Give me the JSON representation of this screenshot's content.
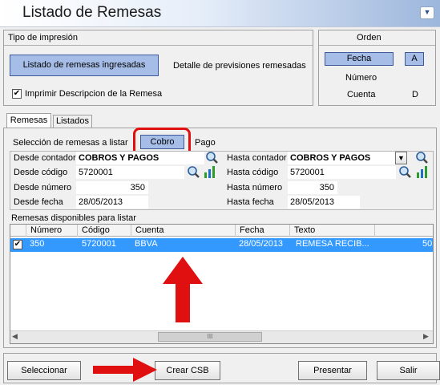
{
  "window": {
    "title": "Listado de Remesas",
    "menu_icon": "chevron-down-icon"
  },
  "tipo_impresion": {
    "title": "Tipo de impresión",
    "btn_ingresadas": "Listado de remesas ingresadas",
    "btn_previsiones": "Detalle de previsiones remesadas",
    "checkbox_label": "Imprimir Descripcion de la Remesa",
    "checkbox_checked": true
  },
  "orden": {
    "title": "Orden",
    "items": [
      {
        "label": "Fecha",
        "value": "A"
      },
      {
        "label": "Número",
        "value": ""
      },
      {
        "label": "Cuenta",
        "value": "D"
      }
    ]
  },
  "tabs": [
    "Remesas",
    "Listados"
  ],
  "seleccion": {
    "label": "Selección de remesas a listar",
    "btn_cobro": "Cobro",
    "btn_pago": "Pago"
  },
  "filters": {
    "desde_contador_label": "Desde contador",
    "desde_contador_value": "COBROS Y PAGOS",
    "hasta_contador_label": "Hasta contador",
    "hasta_contador_value": "COBROS Y PAGOS",
    "desde_codigo_label": "Desde código",
    "desde_codigo_value": "5720001",
    "hasta_codigo_label": "Hasta código",
    "hasta_codigo_value": "5720001",
    "desde_numero_label": "Desde número",
    "desde_numero_value": "350",
    "hasta_numero_label": "Hasta número",
    "hasta_numero_value": "350",
    "desde_fecha_label": "Desde fecha",
    "desde_fecha_value": "28/05/2013",
    "hasta_fecha_label": "Hasta fecha",
    "hasta_fecha_value": "28/05/2013"
  },
  "table": {
    "label": "Remesas disponibles para listar",
    "columns": [
      "Número",
      "Código",
      "Cuenta",
      "Fecha",
      "Texto"
    ],
    "rows": [
      {
        "checked": true,
        "numero": "350",
        "codigo": "5720001",
        "cuenta": "BBVA",
        "fecha": "28/05/2013",
        "texto": "REMESA RECIB...",
        "extra": "50"
      }
    ]
  },
  "buttons": {
    "seleccionar": "Seleccionar",
    "crear_csb": "Crear CSB",
    "presentar": "Presentar",
    "salir": "Salir"
  },
  "colors": {
    "highlight_red": "#e01010",
    "selection_blue": "#3399ff",
    "toggle_blue": "#a6bde8"
  }
}
